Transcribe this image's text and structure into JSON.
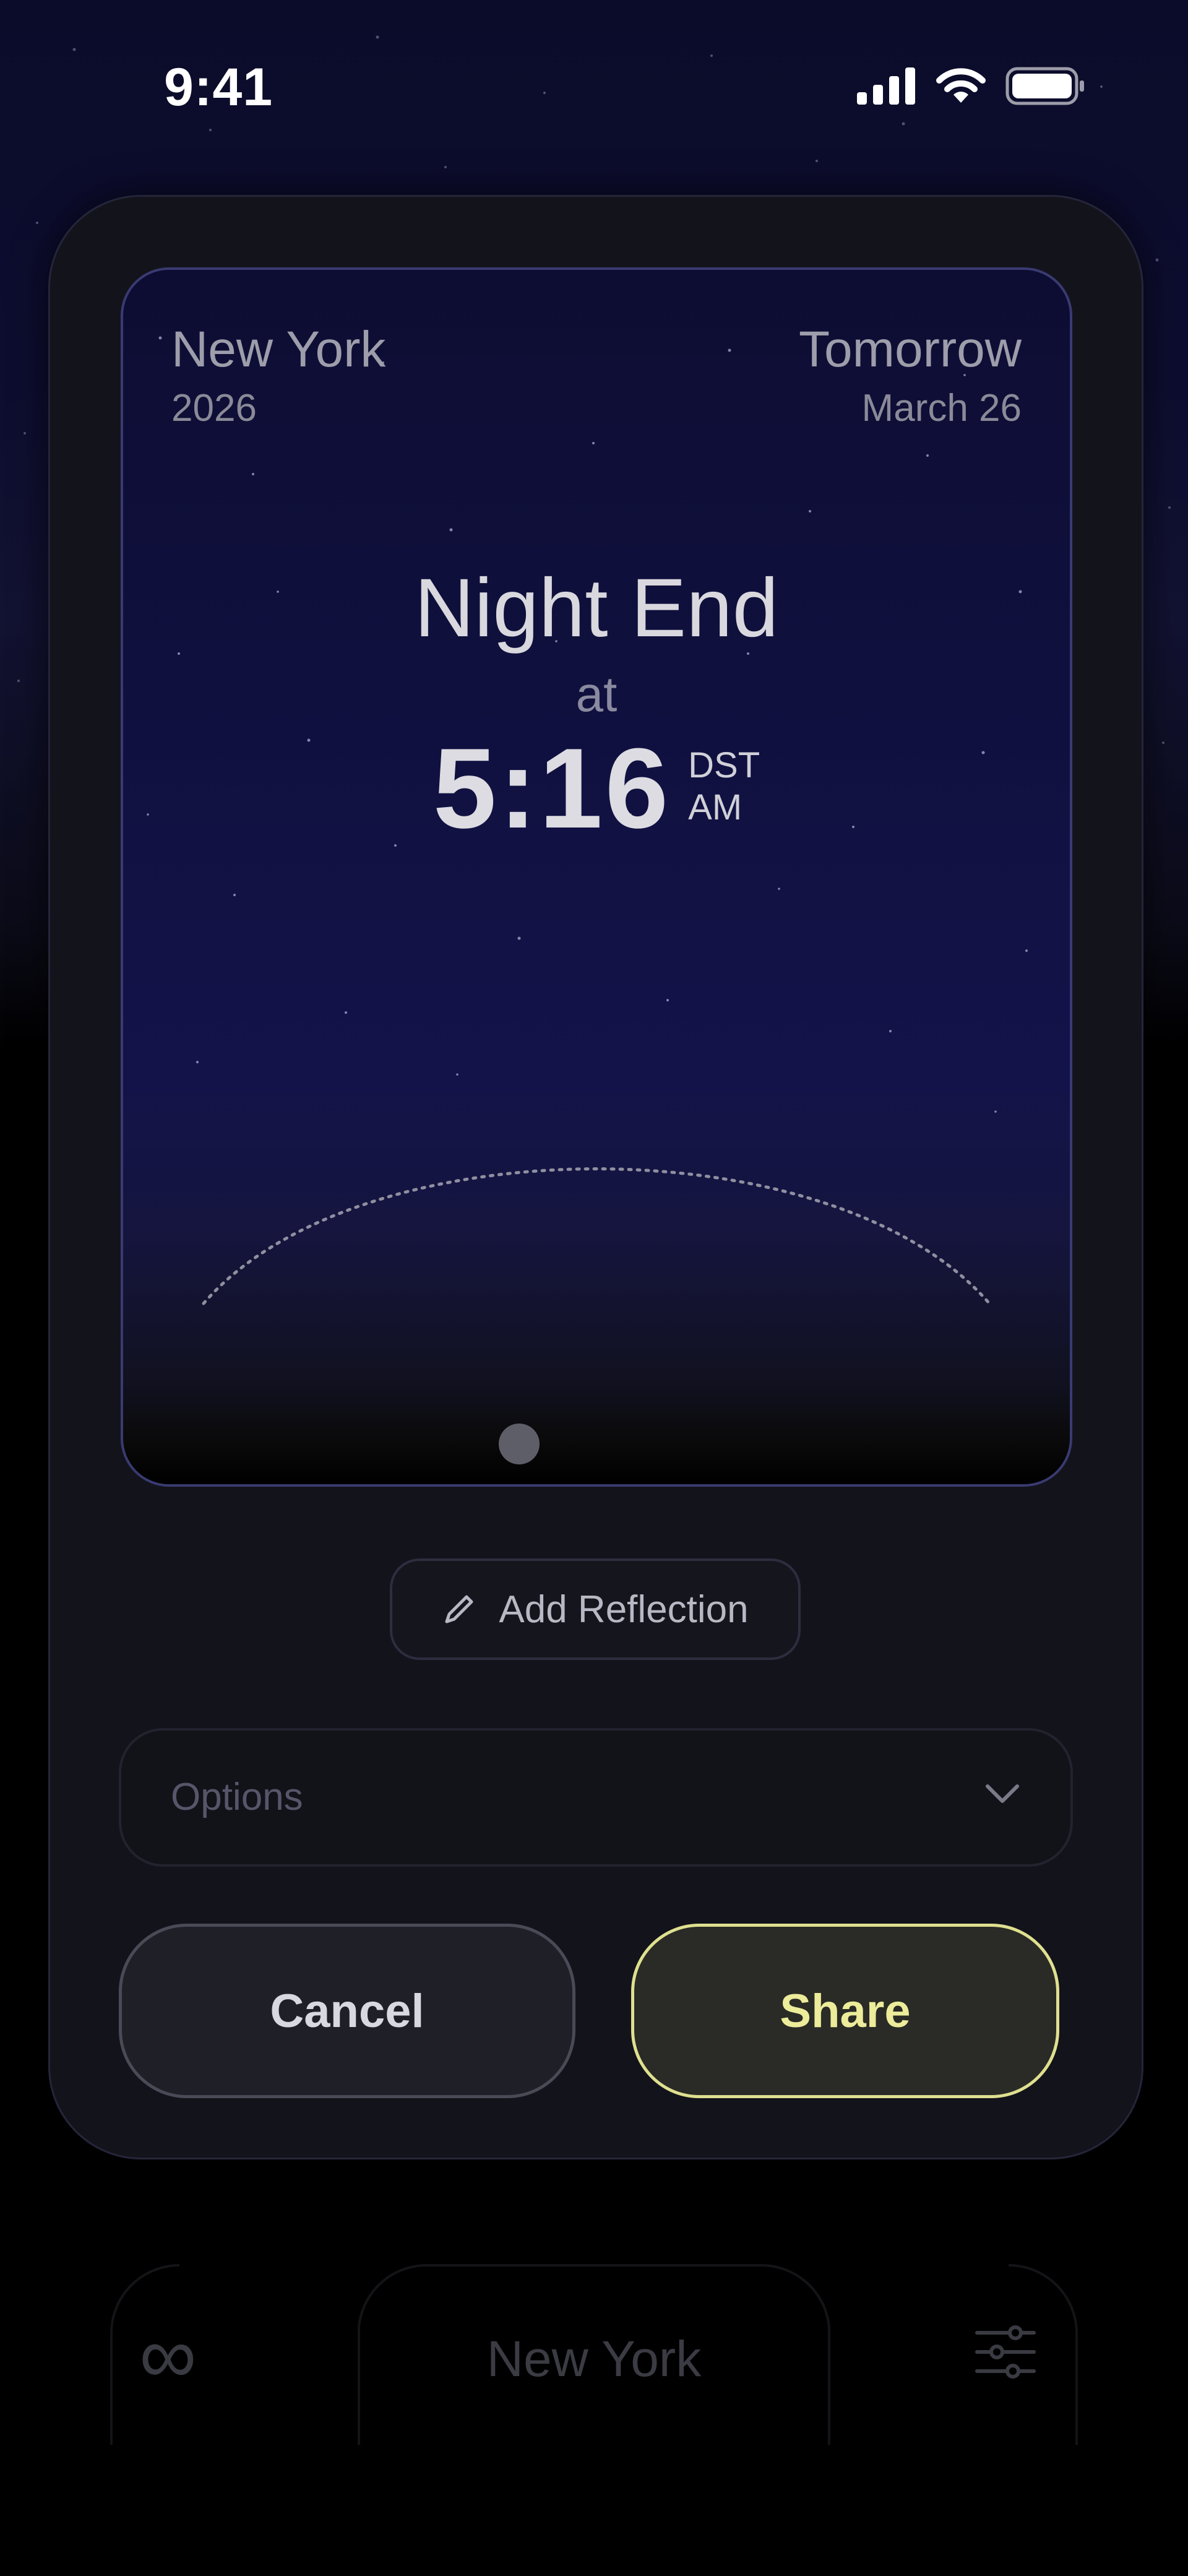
{
  "status_bar": {
    "time": "9:41",
    "signal_icon": "cellular-signal-icon",
    "wifi_icon": "wifi-icon",
    "battery_icon": "battery-icon"
  },
  "event_card": {
    "location": "New York",
    "year": "2026",
    "day_label": "Tomorrow",
    "date": "March 26",
    "event_name": "Night End",
    "at_label": "at",
    "time": "5:16",
    "timezone": "DST",
    "meridiem": "AM"
  },
  "add_reflection": {
    "label": "Add Reflection",
    "icon": "pencil-icon"
  },
  "options": {
    "label": "Options",
    "icon": "chevron-down-icon"
  },
  "actions": {
    "cancel_label": "Cancel",
    "share_label": "Share"
  },
  "tab_bar": {
    "left_icon": "infinity-icon",
    "location": "New York",
    "right_icon": "sliders-icon"
  },
  "colors": {
    "share_accent": "#ecec9a",
    "card_border": "#3a3a72",
    "background": "#0b0b2a"
  }
}
